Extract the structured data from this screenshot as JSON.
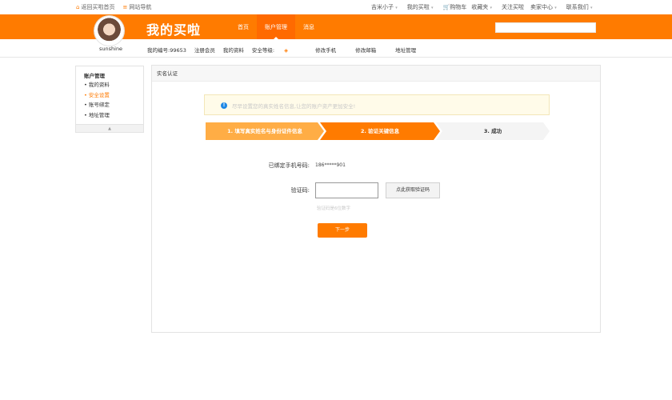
{
  "topbar": {
    "home_link": "返回买啦首页",
    "site_nav": "网站导航",
    "user_menu": "吉米小子",
    "my_maila": "我的买啦",
    "cart": "购物车",
    "favorites": "收藏夹",
    "follow": "关注买啦",
    "seller_center": "卖家中心",
    "contact": "联系我们"
  },
  "header": {
    "logo_text": "我的买啦",
    "nav": [
      {
        "label": "首页"
      },
      {
        "label": "账户管理"
      },
      {
        "label": "消息"
      }
    ],
    "search_placeholder": ""
  },
  "subbar": {
    "username": "sunshine",
    "account_id": "我的编号:99653",
    "register_member": "注册会员",
    "my_profile": "我的资料",
    "security_level": "安全等级:",
    "change_phone": "修改手机",
    "change_email": "修改邮箱",
    "address_mgmt": "地址管理"
  },
  "sidebar": {
    "title": "账户管理",
    "items": [
      {
        "label": "• 我的资料"
      },
      {
        "label": "• 安全设置"
      },
      {
        "label": "• 账号绑定"
      },
      {
        "label": "• 地址管理"
      }
    ]
  },
  "main": {
    "title": "实名认证",
    "notice": "尽早设置您的真实姓名信息,让您的账户资产更加安全!",
    "steps": [
      {
        "label": "1. 填写真实姓名与身份证件信息"
      },
      {
        "label": "2. 验证关键信息"
      },
      {
        "label": "3. 成功"
      }
    ],
    "phone_label": "已绑定手机号码:",
    "phone_value": "186*****901",
    "code_label": "验证码:",
    "code_value": "",
    "get_code_button": "点此获取验证码",
    "hint": "验证码是6位数字",
    "next_button": "下一步"
  },
  "colors": {
    "accent": "#ff7b00",
    "step_done": "#ffad45",
    "step_pending": "#f4f4f4",
    "info_icon": "#1e88e5"
  },
  "icons": {
    "home": "home-icon",
    "menu": "menu-icon",
    "cart": "cart-icon",
    "info": "info-icon",
    "shield": "shield-icon",
    "collapse": "chevron-up-icon"
  }
}
